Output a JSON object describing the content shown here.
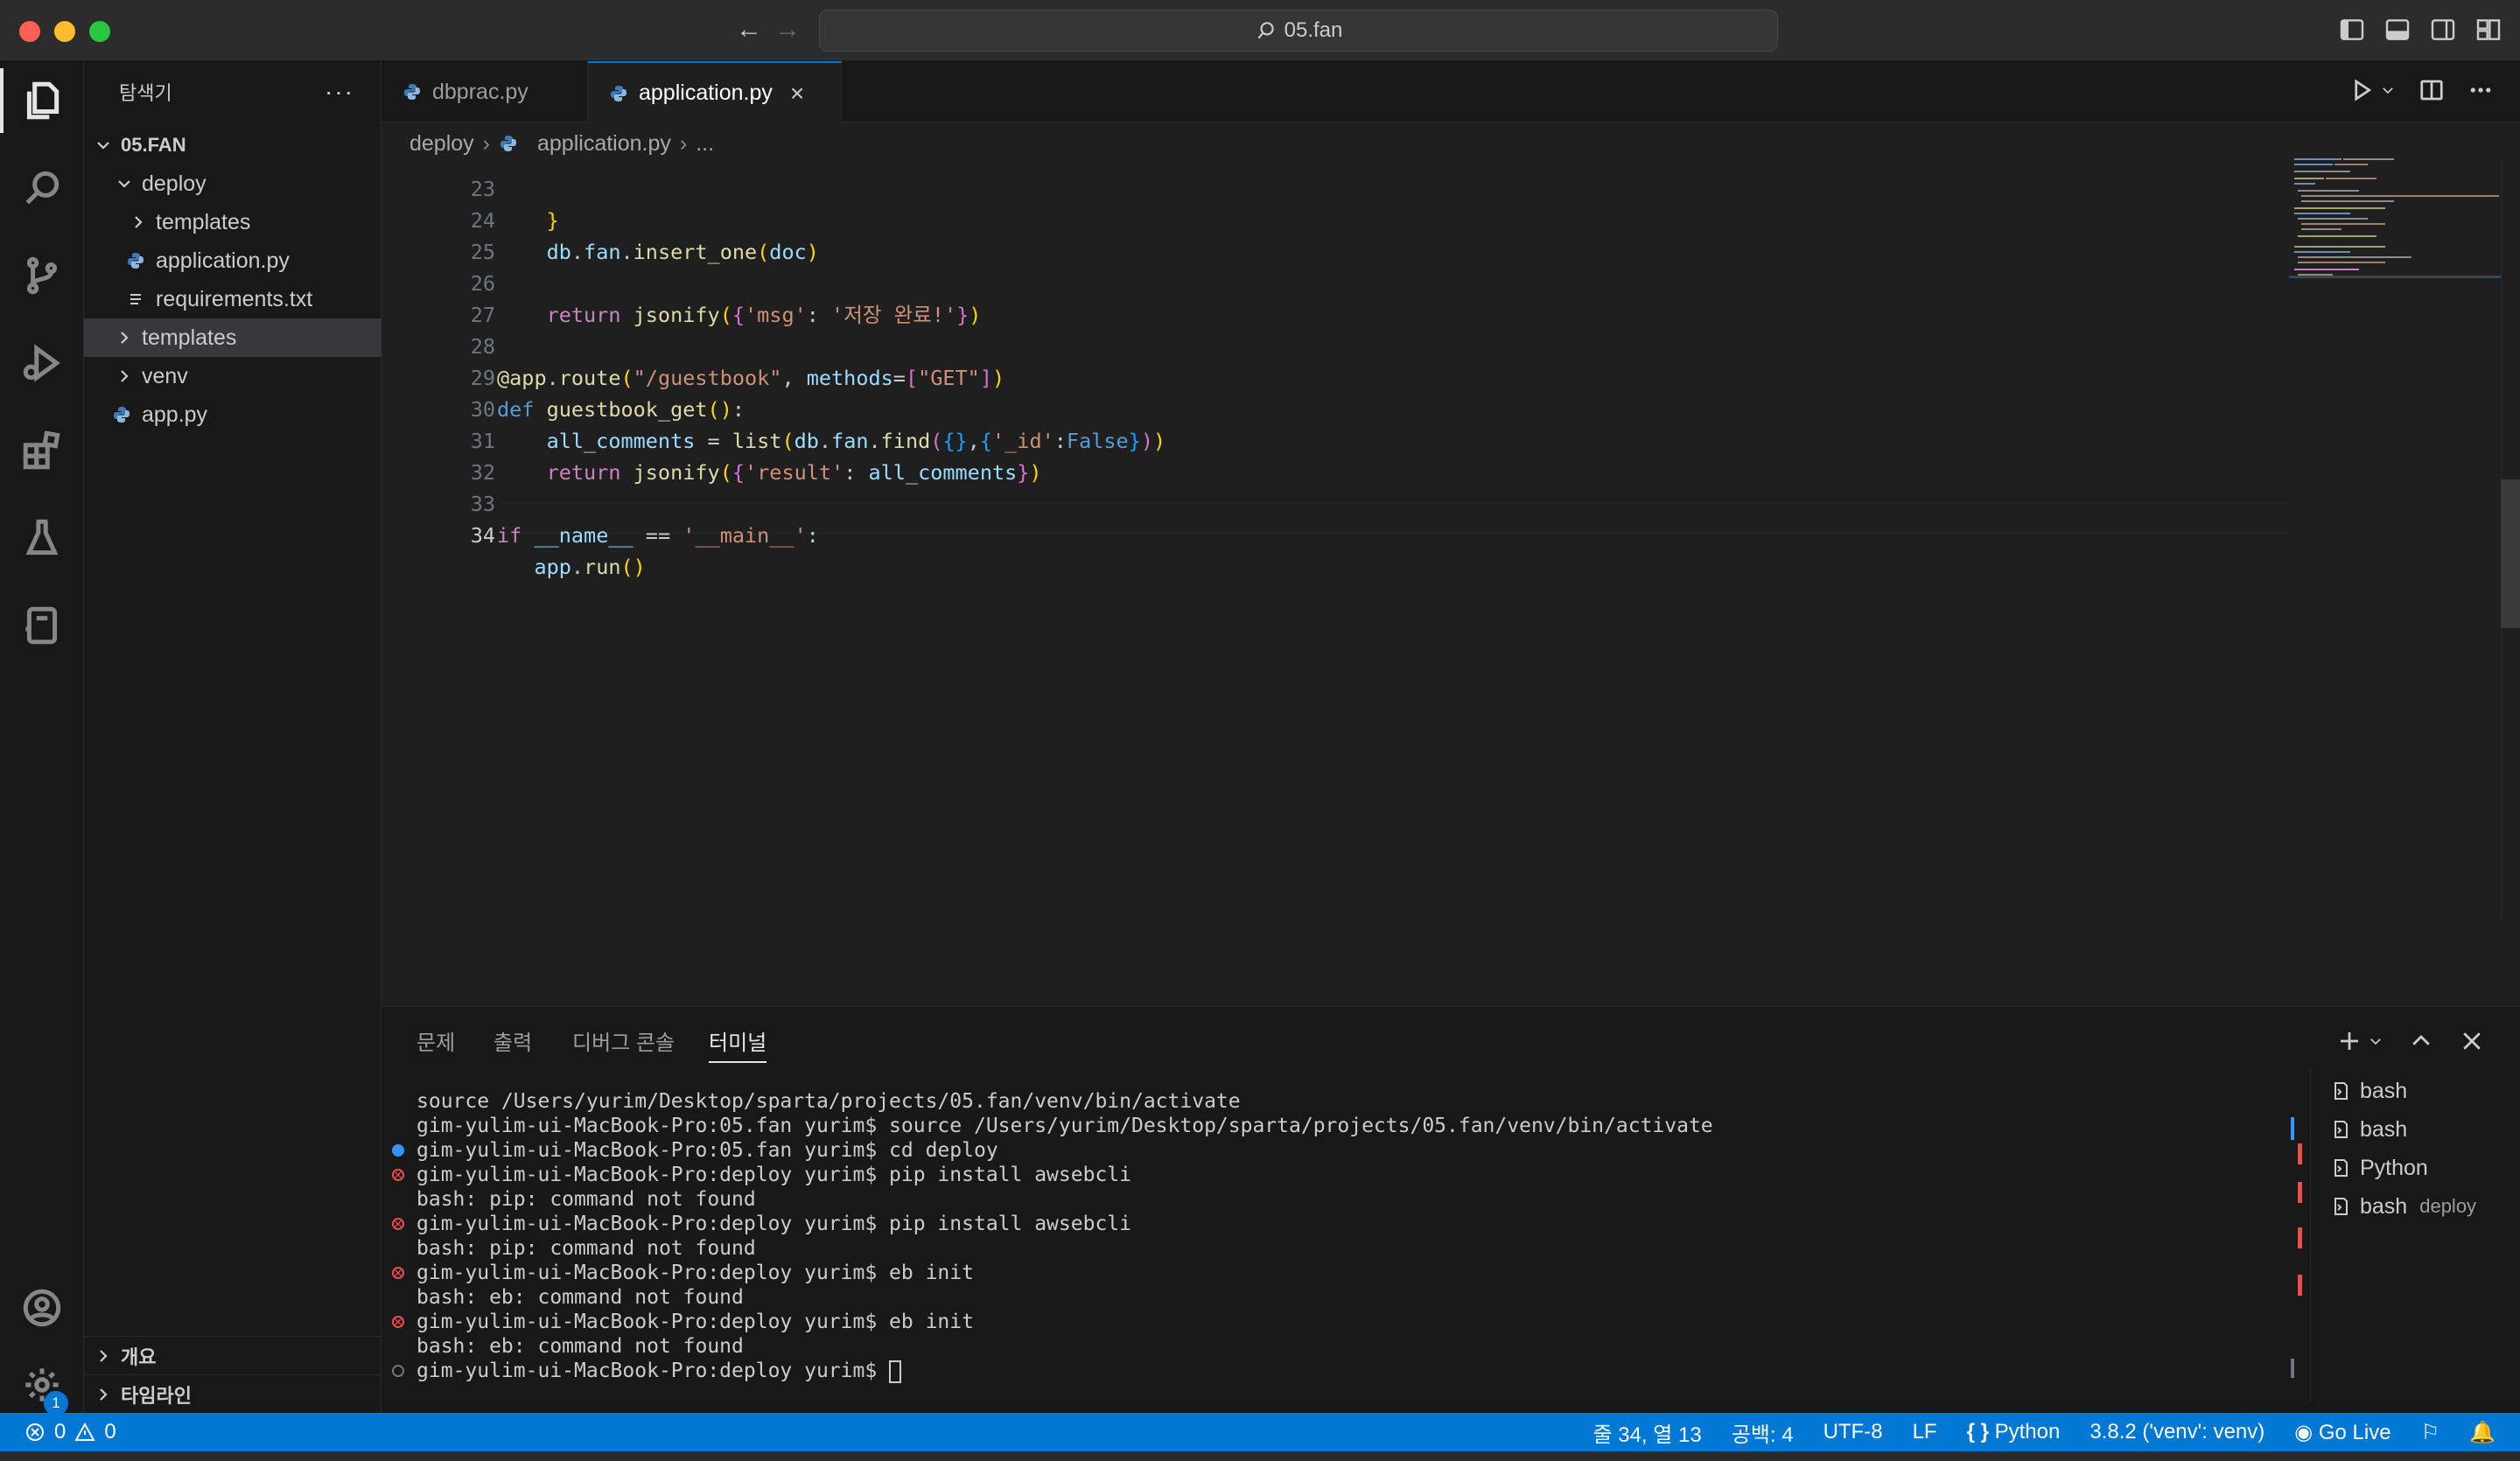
{
  "window": {
    "search_text": "05.fan"
  },
  "sidebar": {
    "title": "탐색기",
    "root": "05.FAN",
    "items": [
      {
        "label": "deploy",
        "kind": "folder-open"
      },
      {
        "label": "templates",
        "kind": "folder"
      },
      {
        "label": "application.py",
        "kind": "python"
      },
      {
        "label": "requirements.txt",
        "kind": "text"
      },
      {
        "label": "templates",
        "kind": "folder"
      },
      {
        "label": "venv",
        "kind": "folder"
      },
      {
        "label": "app.py",
        "kind": "python"
      }
    ],
    "outline": "개요",
    "timeline": "타임라인"
  },
  "tabs": [
    {
      "label": "dbprac.py",
      "active": false
    },
    {
      "label": "application.py",
      "active": true
    }
  ],
  "breadcrumb": {
    "folder": "deploy",
    "file": "application.py",
    "more": "..."
  },
  "code": {
    "lines": [
      {
        "n": "23"
      },
      {
        "n": "24"
      },
      {
        "n": "25"
      },
      {
        "n": "26"
      },
      {
        "n": "27"
      },
      {
        "n": "28"
      },
      {
        "n": "29"
      },
      {
        "n": "30"
      },
      {
        "n": "31"
      },
      {
        "n": "32"
      },
      {
        "n": "33"
      },
      {
        "n": "34"
      }
    ],
    "current_line": "34"
  },
  "panel": {
    "tabs": [
      "문제",
      "출력",
      "디버그 콘솔",
      "터미널"
    ],
    "active_tab": "터미널",
    "terminal_lines": [
      {
        "mark": "none",
        "text": "source /Users/yurim/Desktop/sparta/projects/05.fan/venv/bin/activate"
      },
      {
        "mark": "none",
        "text": "gim-yulim-ui-MacBook-Pro:05.fan yurim$ source /Users/yurim/Desktop/sparta/projects/05.fan/venv/bin/activate"
      },
      {
        "mark": "blue",
        "text": "gim-yulim-ui-MacBook-Pro:05.fan yurim$ cd deploy"
      },
      {
        "mark": "err",
        "text": "gim-yulim-ui-MacBook-Pro:deploy yurim$ pip install awsebcli"
      },
      {
        "mark": "none",
        "text": "bash: pip: command not found"
      },
      {
        "mark": "err",
        "text": "gim-yulim-ui-MacBook-Pro:deploy yurim$ pip install awsebcli"
      },
      {
        "mark": "none",
        "text": "bash: pip: command not found"
      },
      {
        "mark": "err",
        "text": "gim-yulim-ui-MacBook-Pro:deploy yurim$ eb init"
      },
      {
        "mark": "none",
        "text": "bash: eb: command not found"
      },
      {
        "mark": "err",
        "text": "gim-yulim-ui-MacBook-Pro:deploy yurim$ eb init"
      },
      {
        "mark": "none",
        "text": "bash: eb: command not found"
      },
      {
        "mark": "empty",
        "text": "gim-yulim-ui-MacBook-Pro:deploy yurim$ "
      }
    ],
    "terminals": [
      {
        "label": "bash",
        "sub": ""
      },
      {
        "label": "bash",
        "sub": ""
      },
      {
        "label": "Python",
        "sub": ""
      },
      {
        "label": "bash",
        "sub": "deploy"
      }
    ]
  },
  "statusbar": {
    "errors": "0",
    "warnings": "0",
    "position": "줄 34, 열 13",
    "spaces": "공백: 4",
    "encoding": "UTF-8",
    "eol": "LF",
    "language": "Python",
    "interpreter": "3.8.2 ('venv': venv)",
    "golive": "Go Live"
  },
  "colors": {
    "accent": "#0078d4",
    "error": "#f14c4c",
    "keyword": "#569cd6",
    "string": "#ce9178",
    "function": "#dcdcaa"
  }
}
